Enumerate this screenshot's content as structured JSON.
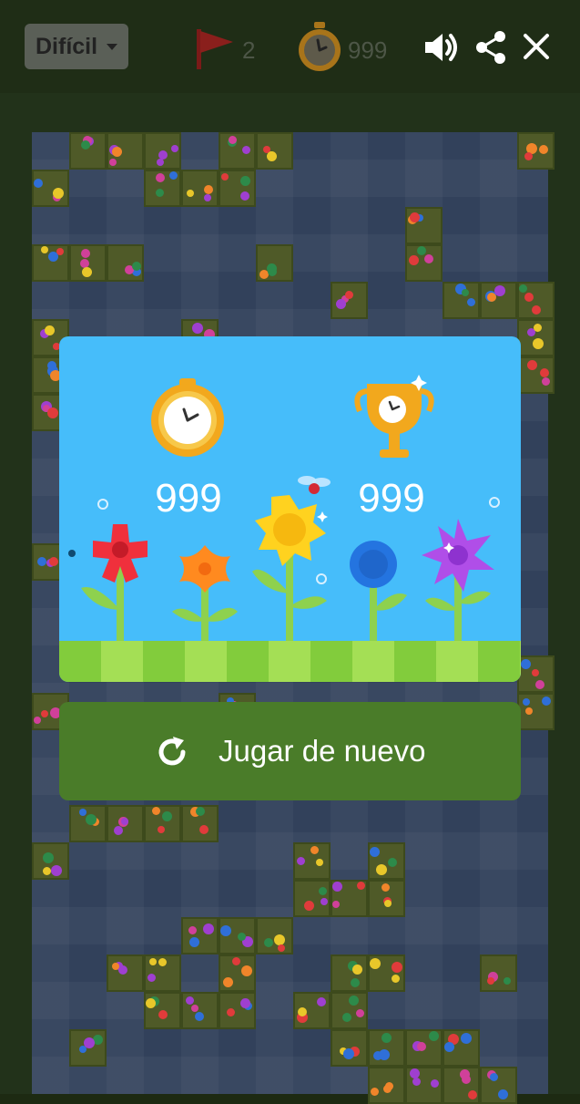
{
  "header": {
    "difficulty_label": "Difícil",
    "flags_remaining": "2",
    "timer_value": "999"
  },
  "result": {
    "time_score": "999",
    "best_score": "999"
  },
  "actions": {
    "play_again_label": "Jugar de nuevo"
  },
  "icons": {
    "flag": "flag-icon",
    "timer": "stopwatch-icon",
    "sound": "speaker-icon",
    "share": "share-icon",
    "close": "close-icon",
    "trophy": "trophy-icon",
    "refresh": "refresh-icon"
  },
  "colors": {
    "card_sky": "#46bdfa",
    "play_again_bg": "#4a7c29",
    "flag_red": "#c8302a",
    "timer_gold": "#f2a81d"
  }
}
